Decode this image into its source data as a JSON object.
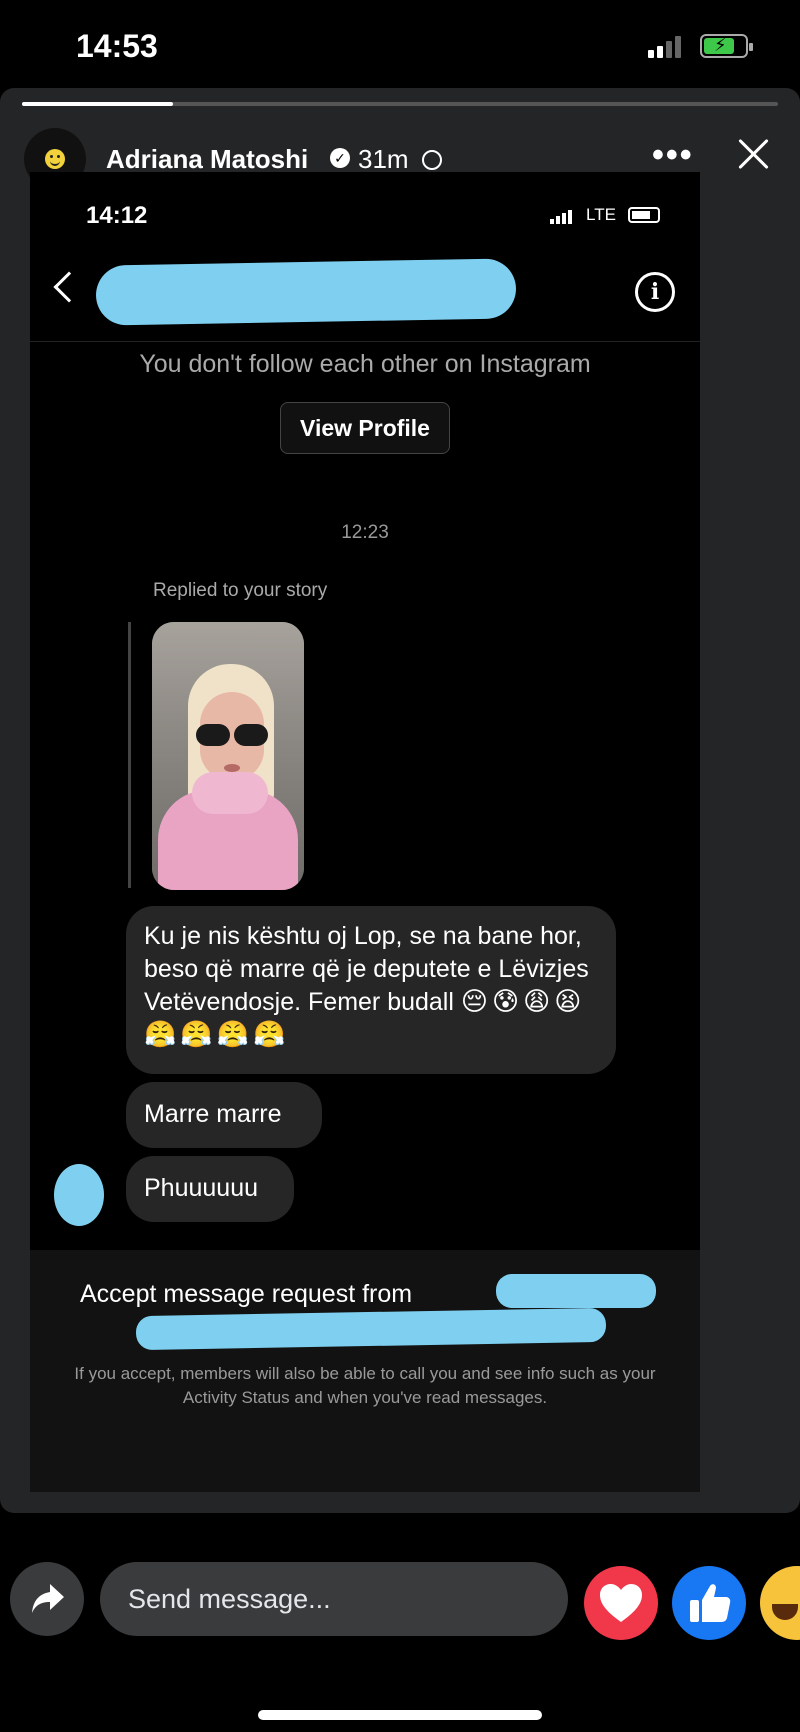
{
  "status_bar": {
    "time": "14:53"
  },
  "story": {
    "author_name": "Adriana Matoshi",
    "posted_ago": "31m",
    "progress": 0.2
  },
  "insta": {
    "time": "14:12",
    "network": "LTE",
    "follow_notice": "You don't follow each other on Instagram",
    "view_profile_label": "View Profile",
    "timestamp": "12:23",
    "replied_label": "Replied to your story",
    "messages": [
      {
        "text": "Ku je nis kështu oj Lop, se na bane hor, beso që marre që je deputete e Lëvizjes Vetëvendosje. Femer budall",
        "emojis": "😔😰😩😫😤😤😤😤"
      },
      {
        "text": "Marre marre"
      },
      {
        "text": "Phuuuuuu"
      }
    ],
    "accept_request": "Accept message request from",
    "request_info": "If you accept, members will also be able to call you and see info such as your Activity Status and when you've read messages."
  },
  "footer": {
    "message_placeholder": "Send message..."
  },
  "colors": {
    "redaction": "#7fd0f0",
    "heart": "#f0384a",
    "like": "#1877f2",
    "haha": "#f7c33b",
    "battery": "#3ec84a"
  }
}
